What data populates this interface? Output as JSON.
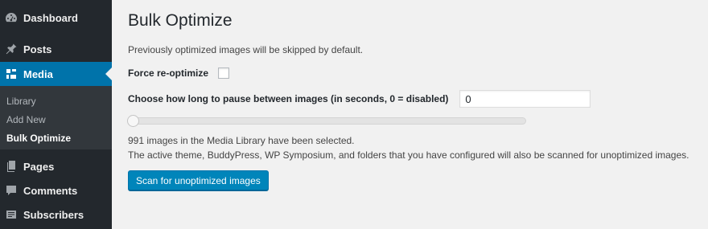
{
  "sidebar": {
    "menu": [
      {
        "label": "Dashboard",
        "icon": "dashboard-icon"
      },
      {
        "label": "Posts",
        "icon": "pin-icon"
      },
      {
        "label": "Media",
        "icon": "media-icon",
        "current": true
      },
      {
        "label": "Pages",
        "icon": "pages-icon"
      },
      {
        "label": "Comments",
        "icon": "comment-icon"
      },
      {
        "label": "Subscribers",
        "icon": "subscribers-icon"
      }
    ],
    "submenu": [
      {
        "label": "Library"
      },
      {
        "label": "Add New"
      },
      {
        "label": "Bulk Optimize",
        "active": true
      }
    ]
  },
  "main": {
    "title": "Bulk Optimize",
    "intro": "Previously optimized images will be skipped by default.",
    "force_label": "Force re-optimize",
    "force_checked": false,
    "pause_label": "Choose how long to pause between images (in seconds, 0 = disabled)",
    "pause_value": "0",
    "slider_value": 0,
    "status_line1": "991 images in the Media Library have been selected.",
    "status_line2": "The active theme, BuddyPress, WP Symposium, and folders that you have configured will also be scanned for unoptimized images.",
    "scan_button": "Scan for unoptimized images"
  },
  "colors": {
    "sidebar_bg": "#23282d",
    "submenu_bg": "#32373c",
    "accent": "#0073aa",
    "button": "#0085ba",
    "page_bg": "#f1f1f1"
  }
}
